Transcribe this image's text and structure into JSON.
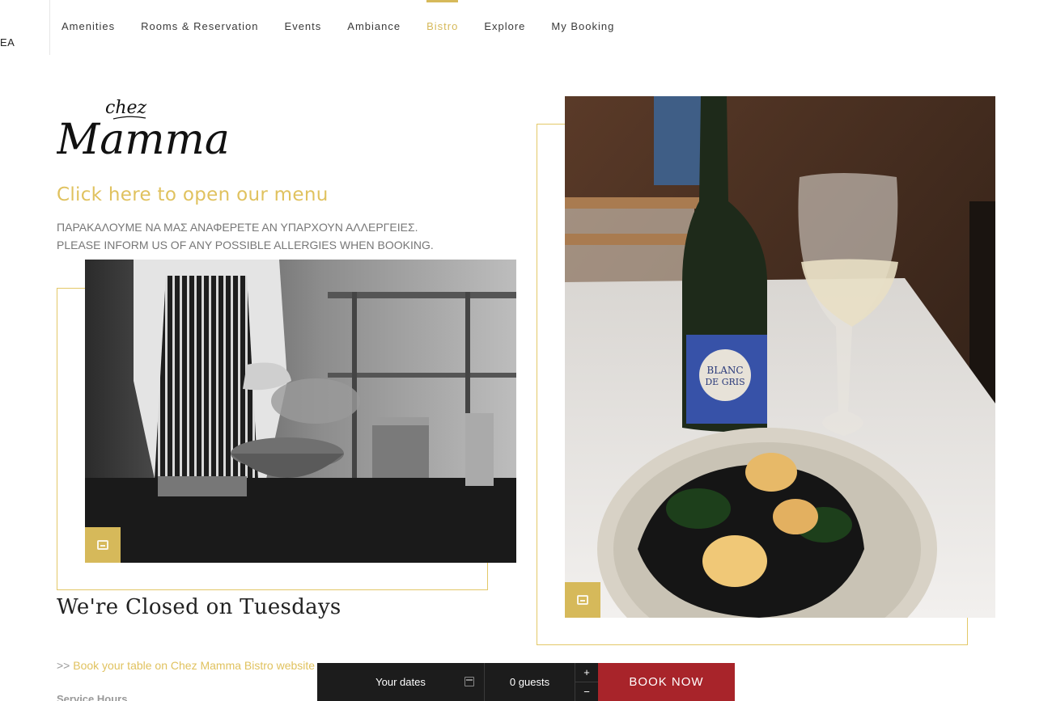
{
  "header": {
    "logo_partial": "EA",
    "nav": [
      {
        "label": "Amenities",
        "active": false
      },
      {
        "label": "Rooms & Reservation",
        "active": false
      },
      {
        "label": "Events",
        "active": false
      },
      {
        "label": "Ambiance",
        "active": false
      },
      {
        "label": "Bistro",
        "active": true
      },
      {
        "label": "Explore",
        "active": false
      },
      {
        "label": "My Booking",
        "active": false
      }
    ]
  },
  "brand": {
    "small_text": "chez",
    "large_text": "Mamma"
  },
  "main": {
    "menu_link": "Click here to open our menu",
    "allergy_greek": "ΠΑΡΑΚΑΛΟΥΜΕ ΝΑ ΜΑΣ ΑΝΑΦΕΡΕΤΕ ΑΝ ΥΠΑΡΧΟΥΝ ΑΛΛΕΡΓΕΙΕΣ.",
    "allergy_english": "PLEASE INFORM US OF ANY POSSIBLE ALLERGIES WHEN BOOKING.",
    "closed_notice": "We're Closed on Tuesdays",
    "book_prefix": ">>",
    "book_link": "Book your table on Chez Mamma Bistro website",
    "service_hours": "Service Hours"
  },
  "wine_label": {
    "line1": "BLANC",
    "line2": "DE GRIS"
  },
  "booking_bar": {
    "dates": "Your dates",
    "guests": "0 guests",
    "plus": "+",
    "minus": "−",
    "book_now": "BOOK NOW"
  },
  "colors": {
    "accent": "#d6b95a",
    "book_button": "#a8242a",
    "bar": "#1c1c1c"
  }
}
